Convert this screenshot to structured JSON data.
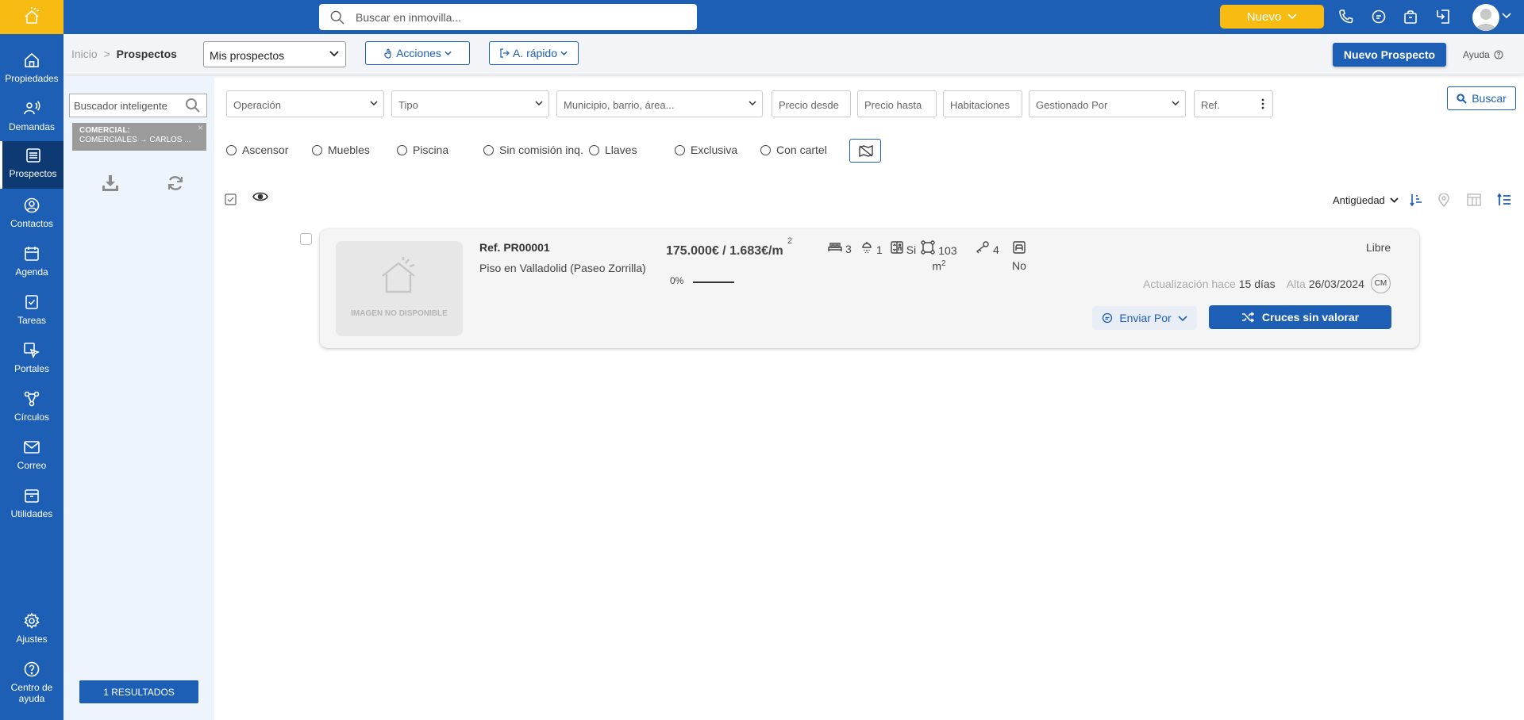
{
  "topbar": {
    "search_placeholder": "Buscar en inmovilla...",
    "nuevo_label": "Nuevo",
    "icons": [
      "phone-icon",
      "chat-icon",
      "bag-icon",
      "exit-icon",
      "avatar"
    ]
  },
  "sidebar": {
    "items": [
      {
        "label": "Propiedades",
        "icon": "home-icon"
      },
      {
        "label": "Demandas",
        "icon": "person-voice-icon"
      },
      {
        "label": "Prospectos",
        "icon": "list-icon",
        "active": true
      },
      {
        "label": "Contactos",
        "icon": "user-circle-icon"
      },
      {
        "label": "Agenda",
        "icon": "calendar-icon"
      },
      {
        "label": "Tareas",
        "icon": "clipboard-check-icon"
      },
      {
        "label": "Portales",
        "icon": "cursor-click-icon"
      },
      {
        "label": "Círculos",
        "icon": "network-icon"
      },
      {
        "label": "Correo",
        "icon": "mail-icon"
      },
      {
        "label": "Utilidades",
        "icon": "box-icon"
      }
    ],
    "bottom": [
      {
        "label": "Ajustes",
        "icon": "gear-icon"
      },
      {
        "label": "Centro de ayuda",
        "icon": "help-icon"
      }
    ]
  },
  "header": {
    "breadcrumb_home": "Inicio",
    "breadcrumb_sep": ">",
    "breadcrumb_current": "Prospectos",
    "view_select": "Mis prospectos",
    "acciones": "Acciones",
    "acceso_rapido": "A. rápido",
    "nuevo_prospecto": "Nuevo Prospecto",
    "ayuda": "Ayuda"
  },
  "leftpanel": {
    "smart_search_placeholder": "Buscador inteligente",
    "tag_title": "COMERCIAL:",
    "tag_value": "COMERCIALES → CARLOS ...",
    "tag_close": "×",
    "results": "1 RESULTADOS"
  },
  "filters": {
    "operacion": "Operación",
    "tipo": "Tipo",
    "municipio": "Municipio, barrio, área...",
    "precio_desde": "Precio desde",
    "precio_hasta": "Precio hasta",
    "habitaciones": "Habitaciones",
    "gestionado": "Gestionado Por",
    "ref": "Ref.",
    "buscar": "Buscar",
    "options": [
      "Ascensor",
      "Muebles",
      "Piscina",
      "Sin comisión inq.",
      "Llaves",
      "Exclusiva",
      "Con cartel"
    ]
  },
  "list": {
    "sort_label": "Antigüedad"
  },
  "card": {
    "image_placeholder": "IMAGEN NO DISPONIBLE",
    "ref": "Ref. PR00001",
    "title": "Piso en Valladolid (Paseo Zorrilla)",
    "price": "175.000€ / 1.683€/m",
    "price_sup": "2",
    "progress_label": "0%",
    "progress": 0,
    "features": [
      {
        "icon": "bed-icon",
        "value": "3"
      },
      {
        "icon": "shower-icon",
        "value": "1"
      },
      {
        "icon": "elevator-icon",
        "value": "Si"
      },
      {
        "icon": "area-icon",
        "value": "103 m",
        "sup": "2"
      },
      {
        "icon": "key-icon",
        "value": "4"
      },
      {
        "icon": "garage-icon",
        "value": "No"
      }
    ],
    "status": "Libre",
    "update_prefix": "Actualización hace",
    "update_value": "15 días",
    "alta_prefix": "Alta",
    "alta_value": "26/03/2024",
    "agent_initials": "CM",
    "enviar": "Enviar Por",
    "cruces": "Cruces sin valorar"
  },
  "colors": {
    "primary": "#1d5fb4",
    "accent": "#f8bb12",
    "sidebar_active": "#0e3a73"
  }
}
